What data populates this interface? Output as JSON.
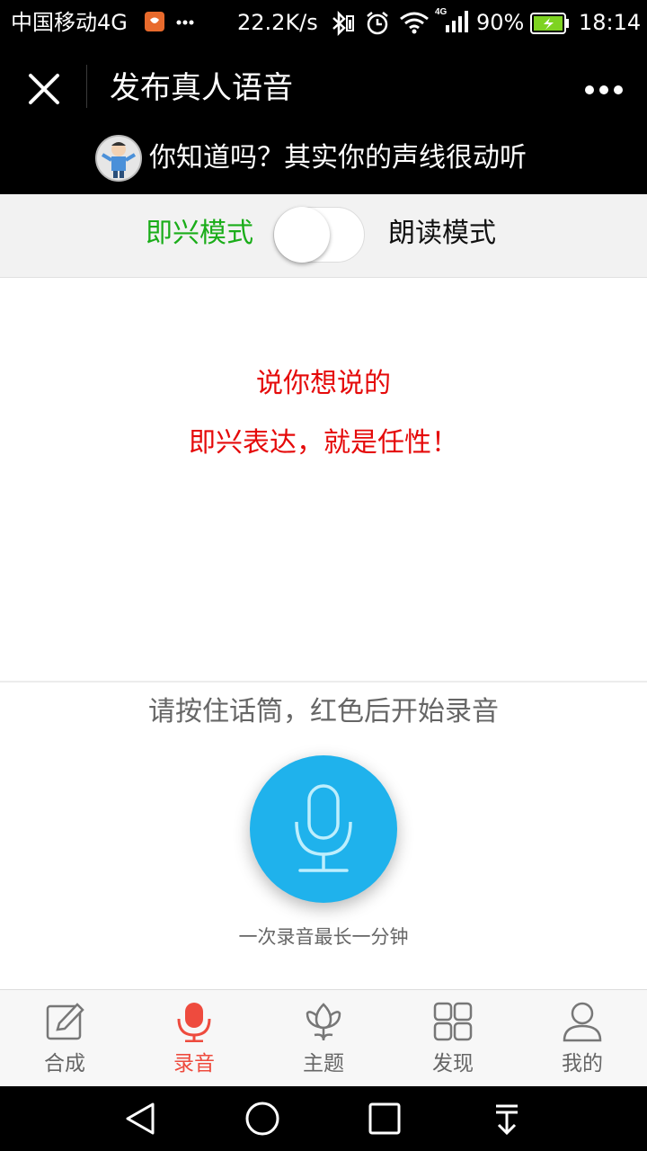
{
  "status_bar": {
    "carrier": "中国移动4G",
    "speed": "22.2K/s",
    "battery": "90%",
    "time": "18:14",
    "icons": [
      "app-notification-icon",
      "more-dots-icon",
      "bluetooth-icon",
      "alarm-icon",
      "wifi-icon",
      "signal-4g-icon",
      "battery-icon"
    ]
  },
  "header": {
    "title": "发布真人语音",
    "icons": [
      "close-icon",
      "more-icon"
    ]
  },
  "banner": {
    "text": "你知道吗？其实你的声线很动听"
  },
  "mode_switch": {
    "left_label": "即兴模式",
    "right_label": "朗读模式",
    "selected": "即兴模式",
    "active_color": "#1aad19"
  },
  "content": {
    "line1": "说你想说的",
    "line2": "即兴表达，就是任性！",
    "color": "#e50a0a"
  },
  "record": {
    "hint": "请按住话筒，红色后开始录音",
    "limit": "一次录音最长一分钟",
    "button_color": "#1fb2ec",
    "icon": "microphone-icon"
  },
  "tabs": [
    {
      "label": "合成",
      "icon": "edit-icon",
      "active": false
    },
    {
      "label": "录音",
      "icon": "microphone-icon",
      "active": true
    },
    {
      "label": "主题",
      "icon": "tulip-icon",
      "active": false
    },
    {
      "label": "发现",
      "icon": "grid-icon",
      "active": false
    },
    {
      "label": "我的",
      "icon": "person-icon",
      "active": false
    }
  ],
  "accent_color": "#ee4b3e",
  "nav_bar": {
    "icons": [
      "back-triangle-icon",
      "home-circle-icon",
      "recents-square-icon",
      "notification-pull-icon"
    ]
  }
}
